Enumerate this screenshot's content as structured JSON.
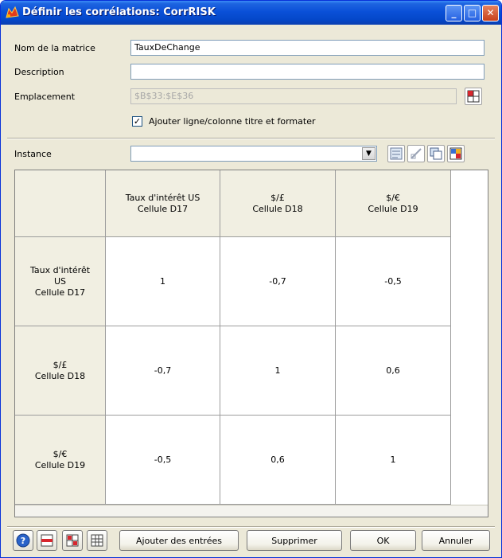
{
  "window": {
    "title": "Définir les corrélations: CorrRISK",
    "minimize_glyph": "_",
    "maximize_glyph": "□",
    "close_glyph": "✕"
  },
  "form": {
    "matrix_name_label": "Nom de la matrice",
    "matrix_name_value": "TauxDeChange",
    "description_label": "Description",
    "description_value": "",
    "location_label": "Emplacement",
    "location_value": "$B$33:$E$36",
    "header_checkbox_label": "Ajouter ligne/colonne titre et formater",
    "header_checkbox_checked": true,
    "instance_label": "Instance",
    "instance_value": ""
  },
  "matrix": {
    "columns": [
      [
        "Taux d'intérêt US",
        "Cellule D17"
      ],
      [
        "$/£",
        "Cellule D18"
      ],
      [
        "$/€",
        "Cellule D19"
      ]
    ],
    "rows": [
      {
        "header": [
          "Taux d'intérêt",
          "US",
          "Cellule D17"
        ],
        "values": [
          "1",
          "-0,7",
          "-0,5"
        ]
      },
      {
        "header": [
          "$/£",
          "Cellule D18"
        ],
        "values": [
          "-0,7",
          "1",
          "0,6"
        ]
      },
      {
        "header": [
          "$/€",
          "Cellule D19"
        ],
        "values": [
          "-0,5",
          "0,6",
          "1"
        ]
      }
    ]
  },
  "buttons": {
    "add_entries": "Ajouter des entrées",
    "delete": "Supprimer",
    "ok": "OK",
    "cancel": "Annuler"
  },
  "icons": [
    "help-icon",
    "insert-row-icon",
    "split-icon",
    "grid-icon",
    "select-range-icon",
    "label-icon",
    "diagonal-icon",
    "copy-matrix-icon",
    "color-matrix-icon"
  ]
}
